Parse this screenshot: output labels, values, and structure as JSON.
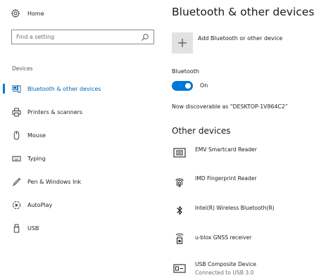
{
  "sidebar": {
    "home_label": "Home",
    "search_placeholder": "Find a setting",
    "section_label": "Devices",
    "items": [
      {
        "label": "Bluetooth & other devices",
        "icon": "bluetooth-devices-icon",
        "active": true
      },
      {
        "label": "Printers & scanners",
        "icon": "printer-icon",
        "active": false
      },
      {
        "label": "Mouse",
        "icon": "mouse-icon",
        "active": false
      },
      {
        "label": "Typing",
        "icon": "keyboard-icon",
        "active": false
      },
      {
        "label": "Pen & Windows Ink",
        "icon": "pen-icon",
        "active": false
      },
      {
        "label": "AutoPlay",
        "icon": "autoplay-icon",
        "active": false
      },
      {
        "label": "USB",
        "icon": "usb-icon",
        "active": false
      }
    ]
  },
  "main": {
    "title": "Bluetooth & other devices",
    "add_device_label": "Add Bluetooth or other device",
    "bluetooth_label": "Bluetooth",
    "bluetooth_state": "On",
    "discoverable_text": "Now discoverable as “DESKTOP-1V864C2”",
    "other_devices_heading": "Other devices",
    "devices": [
      {
        "name": "EMV Smartcard Reader",
        "status": "",
        "icon": "smartcard-reader-icon"
      },
      {
        "name": "IMD Fingerprint Reader",
        "status": "",
        "icon": "fingerprint-icon"
      },
      {
        "name": "Intel(R) Wireless Bluetooth(R)",
        "status": "",
        "icon": "bluetooth-icon"
      },
      {
        "name": "u-blox GNSS receiver",
        "status": "",
        "icon": "gnss-receiver-icon"
      },
      {
        "name": "USB Composite Device",
        "status": "Connected to USB 3.0",
        "icon": "usb-composite-icon"
      }
    ]
  },
  "colors": {
    "accent": "#0078d7",
    "active_text": "#0063b1",
    "tile_bg": "#e2e2e2"
  }
}
